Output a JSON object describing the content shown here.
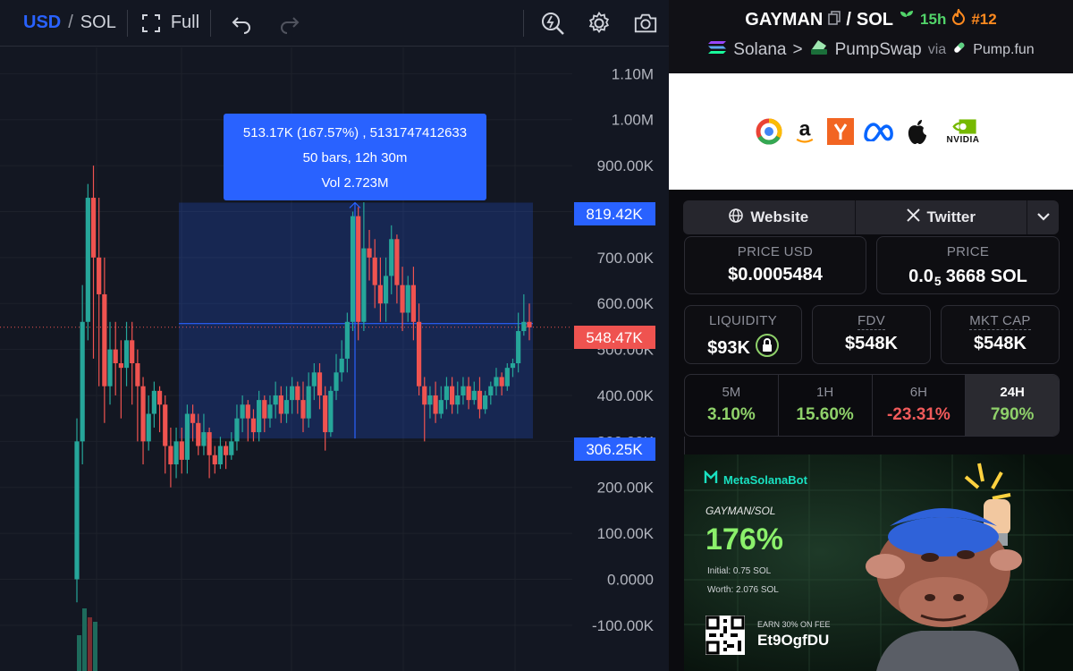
{
  "toolbar": {
    "currency_usd": "USD",
    "currency_sol": "SOL",
    "slash": "/",
    "full_label": "Full"
  },
  "chart_data": {
    "type": "candlestick",
    "y_tick_labels": [
      "1.10M",
      "1.00M",
      "900.00K",
      "800.00K",
      "700.00K",
      "600.00K",
      "500.00K",
      "400.00K",
      "300.00K",
      "200.00K",
      "100.00K",
      "0.0000",
      "-100.00K"
    ],
    "ylim": [
      -120000,
      1150000
    ],
    "price_labels": {
      "range_high": "819.42K",
      "current": "548.47K",
      "range_low": "306.25K"
    },
    "measure_tooltip": {
      "line1": "513.17K (167.57%) , 5131747412633",
      "line2": "50 bars, 12h 30m",
      "line3": "Vol 2.723M"
    },
    "colors": {
      "up": "#26a69a",
      "down": "#ef5350",
      "measure": "#2962ff"
    }
  },
  "pair": {
    "token": "GAYMAN",
    "slash": "/",
    "quote": "SOL",
    "age": "15h",
    "rank": "#12",
    "chain": "Solana",
    "arrow": ">",
    "dex": "PumpSwap",
    "via": "via",
    "launchpad": "Pump.fun"
  },
  "banner": {
    "nvidia_text": "NVIDIA"
  },
  "links": {
    "website": "Website",
    "twitter": "Twitter"
  },
  "stats": {
    "price_usd_label": "PRICE USD",
    "price_usd_value": "$0.0005484",
    "price_label": "PRICE",
    "price_value_prefix": "0.0",
    "price_value_sub": "5",
    "price_value_suffix": "3668 SOL",
    "liquidity_label": "LIQUIDITY",
    "liquidity_value": "$93K",
    "fdv_label": "FDV",
    "fdv_value": "$548K",
    "mktcap_label": "MKT CAP",
    "mktcap_value": "$548K"
  },
  "timeframes": [
    {
      "label": "5M",
      "value": "3.10%"
    },
    {
      "label": "1H",
      "value": "15.60%"
    },
    {
      "label": "6H",
      "value": "-23.31%"
    },
    {
      "label": "24H",
      "value": "790%"
    }
  ],
  "promo": {
    "brand": "MetaSolanaBot",
    "pair": "GAYMAN/SOL",
    "gain": "176%",
    "initial": "Initial:  0.75 SOL",
    "worth": "Worth: 2.076 SOL",
    "earn": "EARN 30% ON FEE",
    "code": "Et9OgfDU"
  }
}
